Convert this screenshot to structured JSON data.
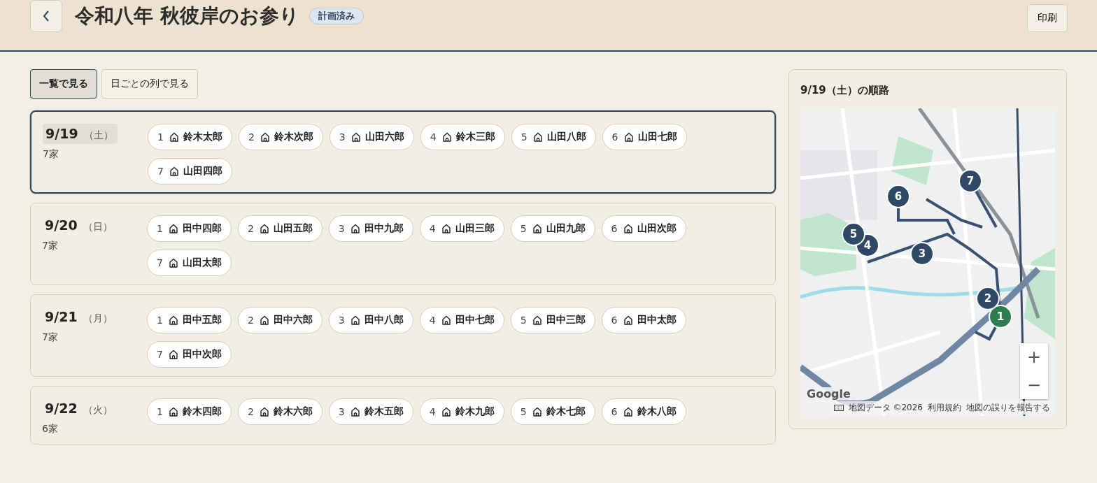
{
  "header": {
    "title": "令和八年 秋彼岸のお参り",
    "status_badge": "計画済み",
    "print_button": "印刷"
  },
  "view_tabs": [
    {
      "label": "一覧で見る",
      "selected": true
    },
    {
      "label": "日ごとの列で見る",
      "selected": false
    }
  ],
  "days": [
    {
      "date": "9/19",
      "weekday": "（土）",
      "count": "7家",
      "selected": true,
      "visits": [
        {
          "order": "1",
          "name": "鈴木太郎"
        },
        {
          "order": "2",
          "name": "鈴木次郎"
        },
        {
          "order": "3",
          "name": "山田六郎"
        },
        {
          "order": "4",
          "name": "鈴木三郎"
        },
        {
          "order": "5",
          "name": "山田八郎"
        },
        {
          "order": "6",
          "name": "山田七郎"
        },
        {
          "order": "7",
          "name": "山田四郎"
        }
      ]
    },
    {
      "date": "9/20",
      "weekday": "（日）",
      "count": "7家",
      "selected": false,
      "visits": [
        {
          "order": "1",
          "name": "田中四郎"
        },
        {
          "order": "2",
          "name": "山田五郎"
        },
        {
          "order": "3",
          "name": "田中九郎"
        },
        {
          "order": "4",
          "name": "山田三郎"
        },
        {
          "order": "5",
          "name": "山田九郎"
        },
        {
          "order": "6",
          "name": "山田次郎"
        },
        {
          "order": "7",
          "name": "山田太郎"
        }
      ]
    },
    {
      "date": "9/21",
      "weekday": "（月）",
      "count": "7家",
      "selected": false,
      "visits": [
        {
          "order": "1",
          "name": "田中五郎"
        },
        {
          "order": "2",
          "name": "田中六郎"
        },
        {
          "order": "3",
          "name": "田中八郎"
        },
        {
          "order": "4",
          "name": "田中七郎"
        },
        {
          "order": "5",
          "name": "田中三郎"
        },
        {
          "order": "6",
          "name": "田中太郎"
        },
        {
          "order": "7",
          "name": "田中次郎"
        }
      ]
    },
    {
      "date": "9/22",
      "weekday": "（火）",
      "count": "6家",
      "selected": false,
      "visits": [
        {
          "order": "1",
          "name": "鈴木四郎"
        },
        {
          "order": "2",
          "name": "鈴木六郎"
        },
        {
          "order": "3",
          "name": "鈴木五郎"
        },
        {
          "order": "4",
          "name": "鈴木九郎"
        },
        {
          "order": "5",
          "name": "鈴木七郎"
        },
        {
          "order": "6",
          "name": "鈴木八郎"
        }
      ]
    }
  ],
  "route_panel": {
    "title": "9/19（土）の順路",
    "map": {
      "kind": "picture",
      "markers": [
        {
          "label": "1",
          "color": "#2e7d4f"
        },
        {
          "label": "2",
          "color": "#2f4865"
        },
        {
          "label": "3",
          "color": "#2f4865"
        },
        {
          "label": "4",
          "color": "#2f4865"
        },
        {
          "label": "5",
          "color": "#2f4865"
        },
        {
          "label": "6",
          "color": "#2f4865"
        },
        {
          "label": "7",
          "color": "#2f4865"
        }
      ],
      "zoom_in": "+",
      "zoom_out": "−",
      "logo": "Google",
      "attribution": [
        "地図データ ©2026",
        "利用規約",
        "地図の誤りを報告する"
      ]
    }
  }
}
